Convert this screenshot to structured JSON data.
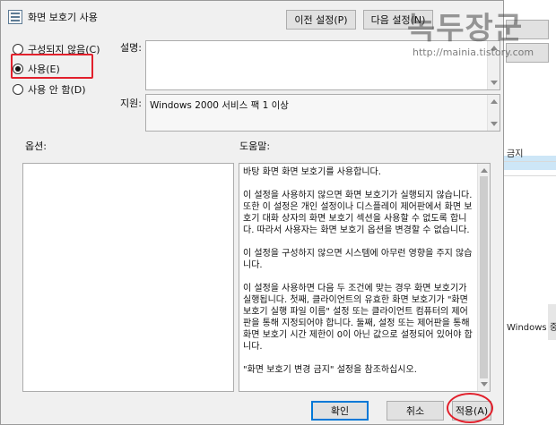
{
  "dialog": {
    "title": "화면 보호기 사용"
  },
  "nav": {
    "prev_label": "이전 설정(P)",
    "next_label": "다음 설정(N)"
  },
  "state": {
    "options": [
      {
        "label": "구성되지 않음(C)",
        "checked": false
      },
      {
        "label": "사용(E)",
        "checked": true
      },
      {
        "label": "사용 안 함(D)",
        "checked": false
      }
    ]
  },
  "comment": {
    "label": "설명:",
    "value": ""
  },
  "supported": {
    "label": "지원:",
    "value": "Windows 2000 서비스 팩 1 이상"
  },
  "options_panel": {
    "label": "옵션:"
  },
  "help": {
    "label": "도움말:",
    "paragraphs": [
      "바탕 화면 화면 보호기를 사용합니다.",
      "이 설정을 사용하지 않으면 화면 보호기가 실행되지 않습니다. 또한 이 설정은 개인 설정이나 디스플레이 제어판에서 화면 보호기 대화 상자의 화면 보호기 섹션을 사용할 수 없도록 합니다. 따라서 사용자는 화면 보호기 옵션을 변경할 수 없습니다.",
      "이 설정을 구성하지 않으면 시스템에 아무런 영향을 주지 않습니다.",
      "이 설정을 사용하면 다음 두 조건에 맞는 경우 화면 보호기가 실행됩니다. 첫째, 클라이언트의 유효한 화면 보호기가 \"화면 보호기 실행 파일 이름\" 설정 또는 클라이언트 컴퓨터의 제어판을 통해 지정되어야 합니다. 둘째, 설정 또는 제어판을 통해 화면 보호기 시간 제한이 0이 아닌 값으로 설정되어 있어야 합니다.",
      "\"화면 보호기 변경 금지\" 설정을 참조하십시오."
    ]
  },
  "footer": {
    "ok_label": "확인",
    "cancel_label": "취소",
    "apply_label": "적용(A)"
  },
  "background": {
    "row1": "금지",
    "row2": "Windows 중"
  },
  "watermark": {
    "logo": "녹두장군",
    "url": "http://mainia.tistory.com"
  },
  "colors": {
    "accent": "#0078d7",
    "annotation": "#e2202c",
    "dialog_bg": "#f0f0f0"
  },
  "icons": {
    "title": "policy-icon"
  }
}
